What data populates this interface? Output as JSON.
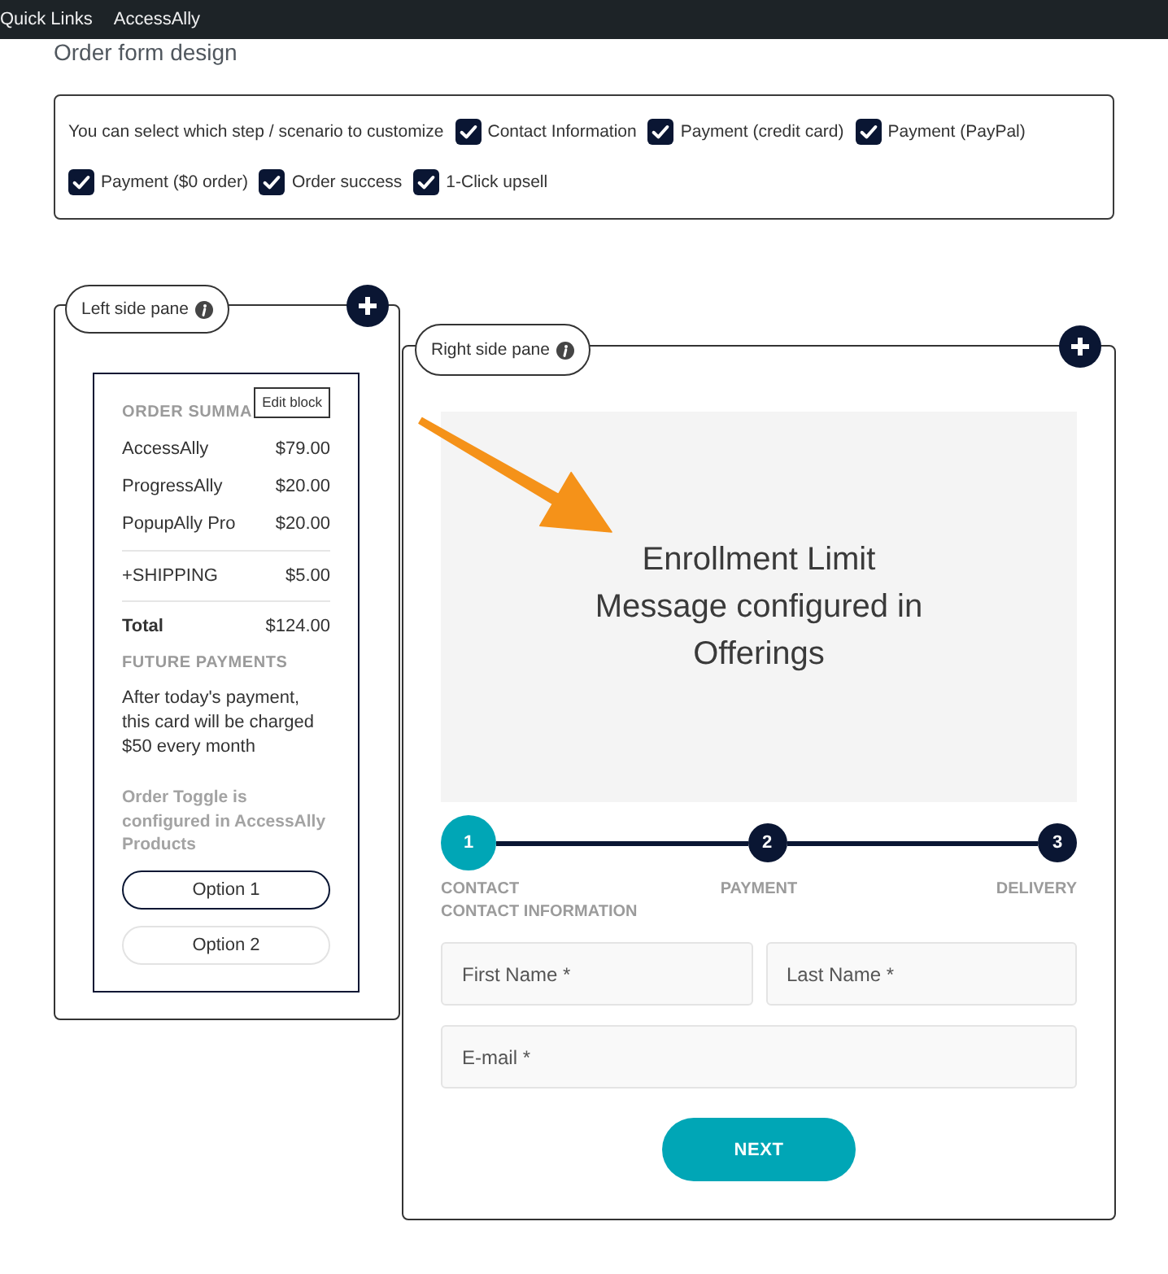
{
  "top_bar": {
    "links": [
      "Quick Links",
      "AccessAlly"
    ]
  },
  "page_title": "Order form design",
  "scenario_selector": {
    "label": "You can select which step / scenario to customize",
    "options": [
      {
        "label": "Contact Information",
        "checked": true
      },
      {
        "label": "Payment (credit card)",
        "checked": true
      },
      {
        "label": "Payment (PayPal)",
        "checked": true
      },
      {
        "label": "Payment ($0 order)",
        "checked": true
      },
      {
        "label": "Order success",
        "checked": true
      },
      {
        "label": "1-Click upsell",
        "checked": true
      }
    ]
  },
  "left_pane": {
    "label": "Left side pane",
    "edit_label": "Edit block",
    "summary_heading": "ORDER SUMMA",
    "items": [
      {
        "name": "AccessAlly",
        "price": "$79.00"
      },
      {
        "name": "ProgressAlly",
        "price": "$20.00"
      },
      {
        "name": "PopupAlly Pro",
        "price": "$20.00"
      }
    ],
    "shipping": {
      "name": "+SHIPPING",
      "price": "$5.00"
    },
    "total": {
      "name": "Total",
      "price": "$124.00"
    },
    "future_heading": "FUTURE PAYMENTS",
    "future_text": "After today's payment, this card will be charged $50 every month",
    "toggle_note": "Order Toggle is configured in AccessAlly Products",
    "options": [
      {
        "label": "Option 1",
        "selected": true
      },
      {
        "label": "Option 2",
        "selected": false
      }
    ]
  },
  "right_pane": {
    "label": "Right side pane",
    "message": "Enrollment Limit Message configured in Offerings",
    "steps": [
      {
        "number": "1",
        "label": "CONTACT",
        "sublabel": "CONTACT INFORMATION",
        "selected": true
      },
      {
        "number": "2",
        "label": "PAYMENT",
        "selected": false
      },
      {
        "number": "3",
        "label": "DELIVERY",
        "selected": false
      }
    ],
    "fields": [
      {
        "placeholder": "First Name *"
      },
      {
        "placeholder": "Last Name *"
      },
      {
        "placeholder": "E-mail *"
      }
    ],
    "next_button": "NEXT"
  }
}
